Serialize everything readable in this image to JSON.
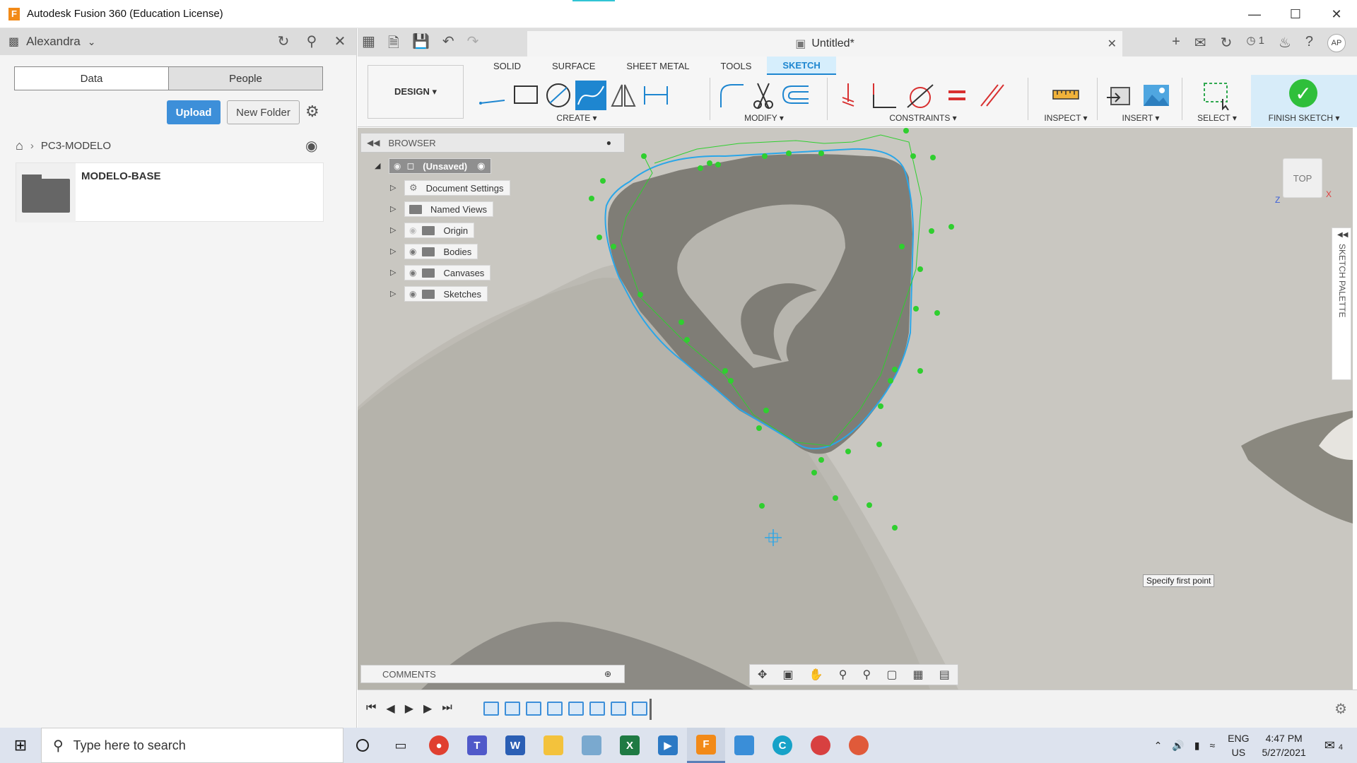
{
  "window": {
    "title": "Autodesk Fusion 360 (Education License)"
  },
  "data_panel": {
    "user": "Alexandra",
    "tabs": [
      "Data",
      "People"
    ],
    "upload_label": "Upload",
    "new_folder_label": "New Folder",
    "breadcrumb": "PC3-MODELO",
    "items": [
      {
        "name": "MODELO-BASE"
      }
    ]
  },
  "document": {
    "tab_title": "Untitled*"
  },
  "ribbon": {
    "workspace": "DESIGN ▾",
    "tabs": [
      "SOLID",
      "SURFACE",
      "SHEET METAL",
      "TOOLS",
      "SKETCH"
    ],
    "active_tab": "SKETCH",
    "groups": {
      "create": "CREATE ▾",
      "modify": "MODIFY ▾",
      "constraints": "CONSTRAINTS ▾",
      "inspect": "INSPECT ▾",
      "insert": "INSERT ▾",
      "select": "SELECT ▾",
      "finish": "FINISH SKETCH ▾"
    }
  },
  "browser": {
    "title": "BROWSER",
    "root": "(Unsaved)",
    "nodes": [
      "Document Settings",
      "Named Views",
      "Origin",
      "Bodies",
      "Canvases",
      "Sketches"
    ]
  },
  "canvas": {
    "viewcube_label": "TOP",
    "sketch_palette": "SKETCH PALETTE",
    "tooltip": "Specify first point",
    "colors": {
      "spline": "#2aa6e8",
      "control_points": "#2fcf2f",
      "background": "#c9c7c1",
      "shape": "#8a8a82"
    }
  },
  "comments": {
    "label": "COMMENTS"
  },
  "taskbar": {
    "search_placeholder": "Type here to search",
    "language": "ENG",
    "region": "US",
    "time": "4:47 PM",
    "date": "5/27/2021",
    "notification_count": "4",
    "apps": [
      "cortana-icon",
      "task-view-icon",
      "chrome-icon",
      "teams-icon",
      "word-icon",
      "file-explorer-icon",
      "app-icon",
      "excel-icon",
      "video-icon",
      "fusion-icon",
      "app-icon-2",
      "app-icon-3",
      "app-icon-4",
      "app-icon-5"
    ]
  },
  "toolbar": {
    "user_initials": "AP",
    "job_count": "1"
  }
}
